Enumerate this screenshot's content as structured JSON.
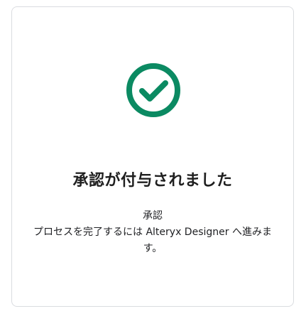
{
  "dialog": {
    "icon": "check-circle-icon",
    "accent_color": "#0b8a62",
    "title": "承認が付与されました",
    "subtitle": "承認",
    "message_line1": "プロセスを完了するには Alteryx Designer へ進みま",
    "message_line2": "す。"
  }
}
